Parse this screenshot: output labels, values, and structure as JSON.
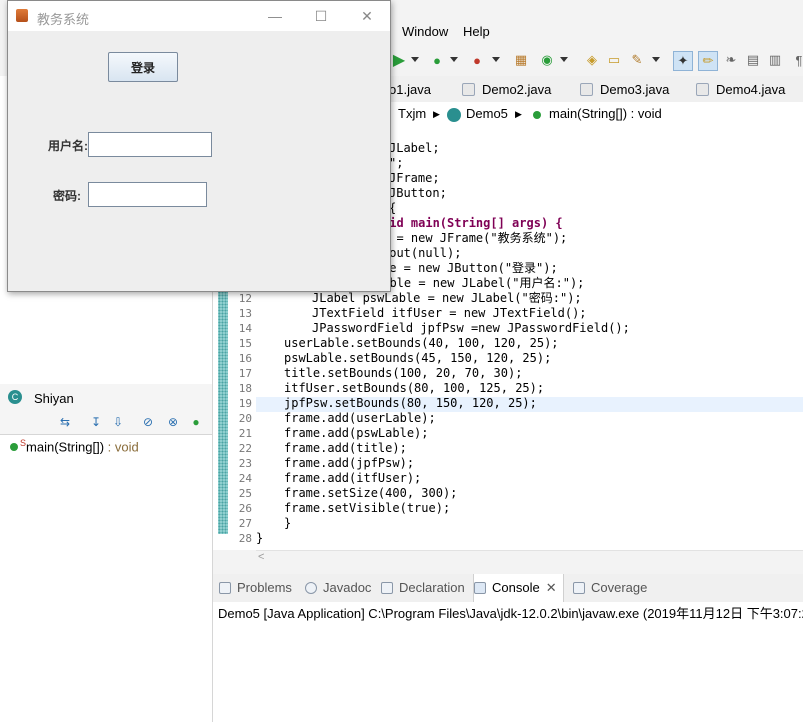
{
  "menu": {
    "window": "Window",
    "help": "Help"
  },
  "editor_tabs": [
    {
      "label": "o1.java"
    },
    {
      "label": "Demo2.java"
    },
    {
      "label": "Demo3.java"
    },
    {
      "label": "Demo4.java"
    }
  ],
  "breadcrumb": {
    "package": "Txjm",
    "class": "Demo5",
    "method": "main(String[]) : void"
  },
  "line_numbers": [
    "12",
    "13",
    "14",
    "15",
    "16",
    "17",
    "18",
    "19",
    "20",
    "21",
    "22",
    "23",
    "24",
    "25",
    "26",
    "27",
    "28"
  ],
  "code_lines": [
    "JLabel;",
    "\";",
    "JFrame;",
    "JButton;",
    "{",
    "oid main(String[] args) {",
    "e = new JFrame(\"教务系统\");",
    "yout(null);",
    "le = new JButton(\"登录\");",
    "Lable = new JLabel(\"用户名:\");",
    "JLabel pswLable = new JLabel(\"密码:\");",
    "JTextField itfUser = new JTextField();",
    "JPasswordField jpfPsw =new JPasswordField();",
    "userLable.setBounds(40, 100, 120, 25);",
    "pswLable.setBounds(45, 150, 120, 25);",
    "title.setBounds(100, 20, 70, 30);",
    "itfUser.setBounds(80, 100, 125, 25);",
    "jpfPsw.setBounds(80, 150, 120, 25);",
    "frame.add(userLable);",
    "frame.add(pswLable);",
    "frame.add(title);",
    "frame.add(jpfPsw);",
    "frame.add(itfUser);",
    "frame.setSize(400, 300);",
    "frame.setVisible(true);",
    "}",
    "}"
  ],
  "outline": {
    "class_name": "Shiyan",
    "method": "main(String[])",
    "method_type": " : void"
  },
  "bottom_tabs": [
    {
      "label": "Problems"
    },
    {
      "label": "Javadoc"
    },
    {
      "label": "Declaration"
    },
    {
      "label": "Console"
    },
    {
      "label": "Coverage"
    }
  ],
  "console": {
    "text": "Demo5 [Java Application] C:\\Program Files\\Java\\jdk-12.0.2\\bin\\javaw.exe (2019年11月12日 下午3:07:2"
  },
  "swing_window": {
    "title": "教务系统",
    "login_button": "登录",
    "username_label": "用户名:",
    "password_label": "密码:",
    "username_value": "",
    "password_value": ""
  },
  "colors": {
    "keyword": "#7f0055",
    "string": "#2a00ff",
    "field": "#0000c0",
    "current_line": "#e8f2fe"
  }
}
